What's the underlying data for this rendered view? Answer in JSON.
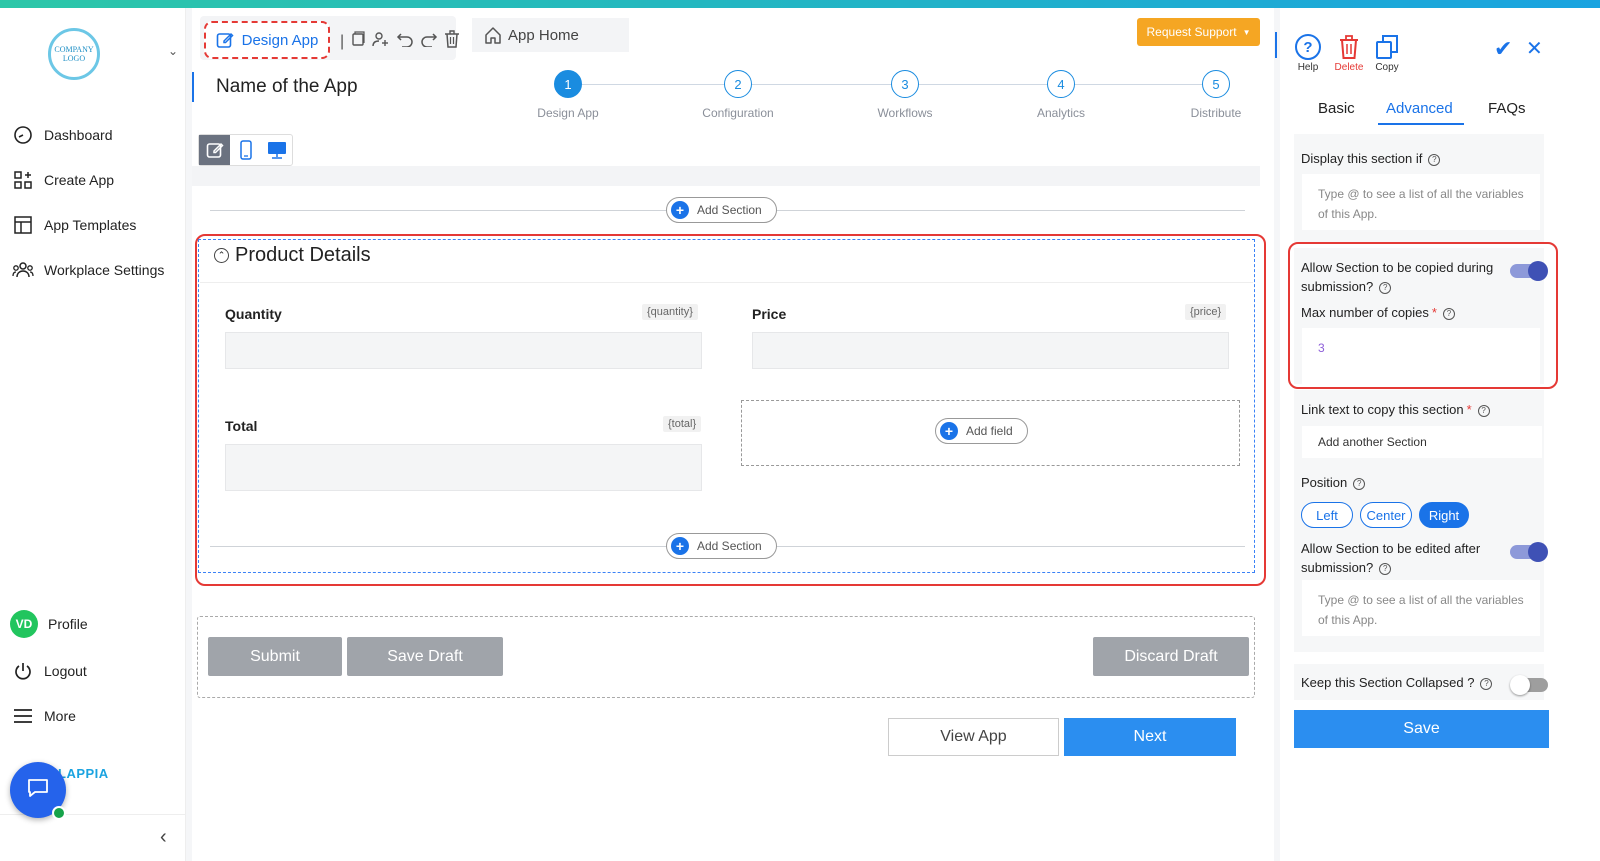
{
  "sidebar": {
    "logo_text": "COMPANY LOGO",
    "nav": [
      {
        "label": "Dashboard",
        "icon": "gauge-icon"
      },
      {
        "label": "Create App",
        "icon": "grid-plus-icon"
      },
      {
        "label": "App Templates",
        "icon": "templates-icon"
      },
      {
        "label": "Workplace Settings",
        "icon": "users-icon"
      }
    ],
    "profile": {
      "initials": "VD",
      "label": "Profile"
    },
    "logout": "Logout",
    "more": "More",
    "brand": "LAPPIA"
  },
  "toolbar": {
    "design_app": "Design App",
    "app_home": "App Home",
    "request_support": "Request Support"
  },
  "app": {
    "name": "Name of the App"
  },
  "steps": [
    {
      "num": "1",
      "label": "Design App",
      "active": true
    },
    {
      "num": "2",
      "label": "Configuration"
    },
    {
      "num": "3",
      "label": "Workflows"
    },
    {
      "num": "4",
      "label": "Analytics"
    },
    {
      "num": "5",
      "label": "Distribute"
    }
  ],
  "form": {
    "add_section": "Add Section",
    "add_field": "Add field",
    "section_title": "Product Details",
    "fields": [
      {
        "label": "Quantity",
        "tag": "{quantity}"
      },
      {
        "label": "Price",
        "tag": "{price}"
      },
      {
        "label": "Total",
        "tag": "{total}"
      }
    ],
    "buttons": {
      "submit": "Submit",
      "save_draft": "Save Draft",
      "discard_draft": "Discard Draft"
    },
    "view_app": "View App",
    "next": "Next"
  },
  "panel": {
    "tools": {
      "help": "Help",
      "delete": "Delete",
      "copy": "Copy"
    },
    "tabs": [
      "Basic",
      "Advanced",
      "FAQs"
    ],
    "display_if": {
      "label": "Display this section if",
      "placeholder": "Type @ to see a list of all the variables of this App."
    },
    "allow_copy": {
      "label": "Allow Section to be copied during submission?",
      "on": true
    },
    "max_copies": {
      "label": "Max number of copies",
      "value": "3"
    },
    "link_text": {
      "label": "Link text to copy this section",
      "value": "Add another Section"
    },
    "position": {
      "label": "Position",
      "options": [
        "Left",
        "Center",
        "Right"
      ],
      "selected": "Right"
    },
    "allow_edit": {
      "label": "Allow Section to be edited after submission?",
      "on": true,
      "placeholder": "Type @ to see a list of all the variables of this App."
    },
    "keep_collapsed": {
      "label": "Keep this Section Collapsed ?",
      "on": false
    },
    "save": "Save"
  },
  "colors": {
    "accent": "#1a73e8",
    "highlight": "#e53935",
    "support": "#f5a623"
  }
}
